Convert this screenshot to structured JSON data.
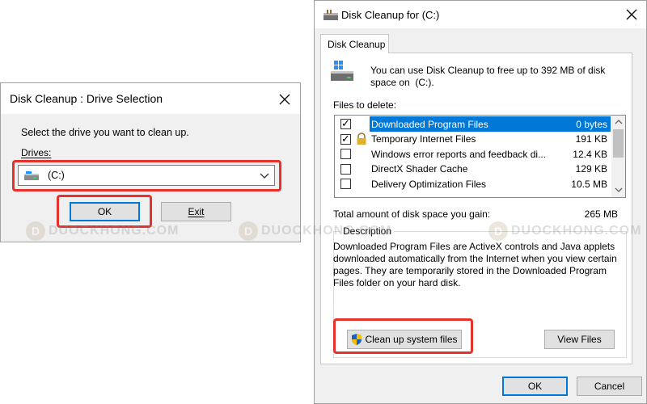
{
  "drive_dialog": {
    "title": "Disk Cleanup : Drive Selection",
    "prompt": "Select the drive you want to clean up.",
    "drives_label": "Drives:",
    "selected_drive": "(C:)",
    "ok_label": "OK",
    "exit_label": "Exit"
  },
  "cleanup_dialog": {
    "title": "Disk Cleanup for  (C:)",
    "tab_label": "Disk Cleanup",
    "intro_line1": "You can use Disk Cleanup to free up to 392 MB of disk",
    "intro_line2": "space on  (C:).",
    "files_to_delete_label": "Files to delete:",
    "files": [
      {
        "name": "Downloaded Program Files",
        "size": "0 bytes",
        "checked": true,
        "selected": true
      },
      {
        "name": "Temporary Internet Files",
        "size": "191 KB",
        "checked": true,
        "selected": false
      },
      {
        "name": "Windows error reports and feedback di...",
        "size": "12.4 KB",
        "checked": false,
        "selected": false
      },
      {
        "name": "DirectX Shader Cache",
        "size": "129 KB",
        "checked": false,
        "selected": false
      },
      {
        "name": "Delivery Optimization Files",
        "size": "10.5 MB",
        "checked": false,
        "selected": false
      }
    ],
    "total_label": "Total amount of disk space you gain:",
    "total_value": "265 MB",
    "description_label": "Description",
    "description_lines": [
      "Downloaded Program Files are ActiveX controls and Java applets",
      "downloaded automatically from the Internet when you view certain",
      "pages. They are temporarily stored in the Downloaded Program",
      "Files folder on your hard disk."
    ],
    "cleanup_system_label": "Clean up system files",
    "view_files_label": "View Files",
    "ok_label": "OK",
    "cancel_label": "Cancel"
  },
  "watermark": {
    "logo_letter": "D",
    "text": "DUOCKHONG.COM"
  },
  "colors": {
    "highlight": "#0078d7",
    "callout_red": "#e5322d",
    "dialog_bg": "#f0f0f0"
  }
}
